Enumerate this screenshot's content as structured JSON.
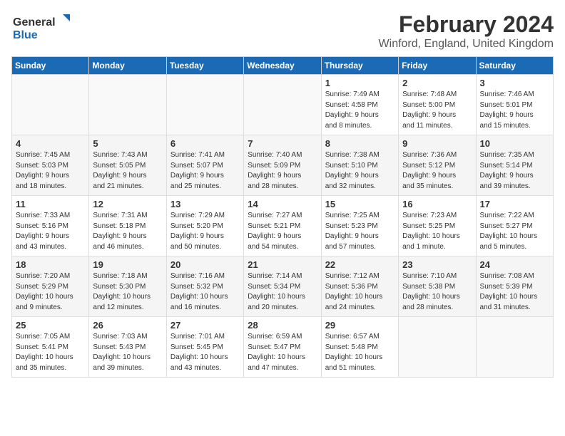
{
  "header": {
    "logo_general": "General",
    "logo_blue": "Blue",
    "month": "February 2024",
    "location": "Winford, England, United Kingdom"
  },
  "days_of_week": [
    "Sunday",
    "Monday",
    "Tuesday",
    "Wednesday",
    "Thursday",
    "Friday",
    "Saturday"
  ],
  "weeks": [
    [
      {
        "day": "",
        "info": ""
      },
      {
        "day": "",
        "info": ""
      },
      {
        "day": "",
        "info": ""
      },
      {
        "day": "",
        "info": ""
      },
      {
        "day": "1",
        "info": "Sunrise: 7:49 AM\nSunset: 4:58 PM\nDaylight: 9 hours\nand 8 minutes."
      },
      {
        "day": "2",
        "info": "Sunrise: 7:48 AM\nSunset: 5:00 PM\nDaylight: 9 hours\nand 11 minutes."
      },
      {
        "day": "3",
        "info": "Sunrise: 7:46 AM\nSunset: 5:01 PM\nDaylight: 9 hours\nand 15 minutes."
      }
    ],
    [
      {
        "day": "4",
        "info": "Sunrise: 7:45 AM\nSunset: 5:03 PM\nDaylight: 9 hours\nand 18 minutes."
      },
      {
        "day": "5",
        "info": "Sunrise: 7:43 AM\nSunset: 5:05 PM\nDaylight: 9 hours\nand 21 minutes."
      },
      {
        "day": "6",
        "info": "Sunrise: 7:41 AM\nSunset: 5:07 PM\nDaylight: 9 hours\nand 25 minutes."
      },
      {
        "day": "7",
        "info": "Sunrise: 7:40 AM\nSunset: 5:09 PM\nDaylight: 9 hours\nand 28 minutes."
      },
      {
        "day": "8",
        "info": "Sunrise: 7:38 AM\nSunset: 5:10 PM\nDaylight: 9 hours\nand 32 minutes."
      },
      {
        "day": "9",
        "info": "Sunrise: 7:36 AM\nSunset: 5:12 PM\nDaylight: 9 hours\nand 35 minutes."
      },
      {
        "day": "10",
        "info": "Sunrise: 7:35 AM\nSunset: 5:14 PM\nDaylight: 9 hours\nand 39 minutes."
      }
    ],
    [
      {
        "day": "11",
        "info": "Sunrise: 7:33 AM\nSunset: 5:16 PM\nDaylight: 9 hours\nand 43 minutes."
      },
      {
        "day": "12",
        "info": "Sunrise: 7:31 AM\nSunset: 5:18 PM\nDaylight: 9 hours\nand 46 minutes."
      },
      {
        "day": "13",
        "info": "Sunrise: 7:29 AM\nSunset: 5:20 PM\nDaylight: 9 hours\nand 50 minutes."
      },
      {
        "day": "14",
        "info": "Sunrise: 7:27 AM\nSunset: 5:21 PM\nDaylight: 9 hours\nand 54 minutes."
      },
      {
        "day": "15",
        "info": "Sunrise: 7:25 AM\nSunset: 5:23 PM\nDaylight: 9 hours\nand 57 minutes."
      },
      {
        "day": "16",
        "info": "Sunrise: 7:23 AM\nSunset: 5:25 PM\nDaylight: 10 hours\nand 1 minute."
      },
      {
        "day": "17",
        "info": "Sunrise: 7:22 AM\nSunset: 5:27 PM\nDaylight: 10 hours\nand 5 minutes."
      }
    ],
    [
      {
        "day": "18",
        "info": "Sunrise: 7:20 AM\nSunset: 5:29 PM\nDaylight: 10 hours\nand 9 minutes."
      },
      {
        "day": "19",
        "info": "Sunrise: 7:18 AM\nSunset: 5:30 PM\nDaylight: 10 hours\nand 12 minutes."
      },
      {
        "day": "20",
        "info": "Sunrise: 7:16 AM\nSunset: 5:32 PM\nDaylight: 10 hours\nand 16 minutes."
      },
      {
        "day": "21",
        "info": "Sunrise: 7:14 AM\nSunset: 5:34 PM\nDaylight: 10 hours\nand 20 minutes."
      },
      {
        "day": "22",
        "info": "Sunrise: 7:12 AM\nSunset: 5:36 PM\nDaylight: 10 hours\nand 24 minutes."
      },
      {
        "day": "23",
        "info": "Sunrise: 7:10 AM\nSunset: 5:38 PM\nDaylight: 10 hours\nand 28 minutes."
      },
      {
        "day": "24",
        "info": "Sunrise: 7:08 AM\nSunset: 5:39 PM\nDaylight: 10 hours\nand 31 minutes."
      }
    ],
    [
      {
        "day": "25",
        "info": "Sunrise: 7:05 AM\nSunset: 5:41 PM\nDaylight: 10 hours\nand 35 minutes."
      },
      {
        "day": "26",
        "info": "Sunrise: 7:03 AM\nSunset: 5:43 PM\nDaylight: 10 hours\nand 39 minutes."
      },
      {
        "day": "27",
        "info": "Sunrise: 7:01 AM\nSunset: 5:45 PM\nDaylight: 10 hours\nand 43 minutes."
      },
      {
        "day": "28",
        "info": "Sunrise: 6:59 AM\nSunset: 5:47 PM\nDaylight: 10 hours\nand 47 minutes."
      },
      {
        "day": "29",
        "info": "Sunrise: 6:57 AM\nSunset: 5:48 PM\nDaylight: 10 hours\nand 51 minutes."
      },
      {
        "day": "",
        "info": ""
      },
      {
        "day": "",
        "info": ""
      }
    ]
  ]
}
